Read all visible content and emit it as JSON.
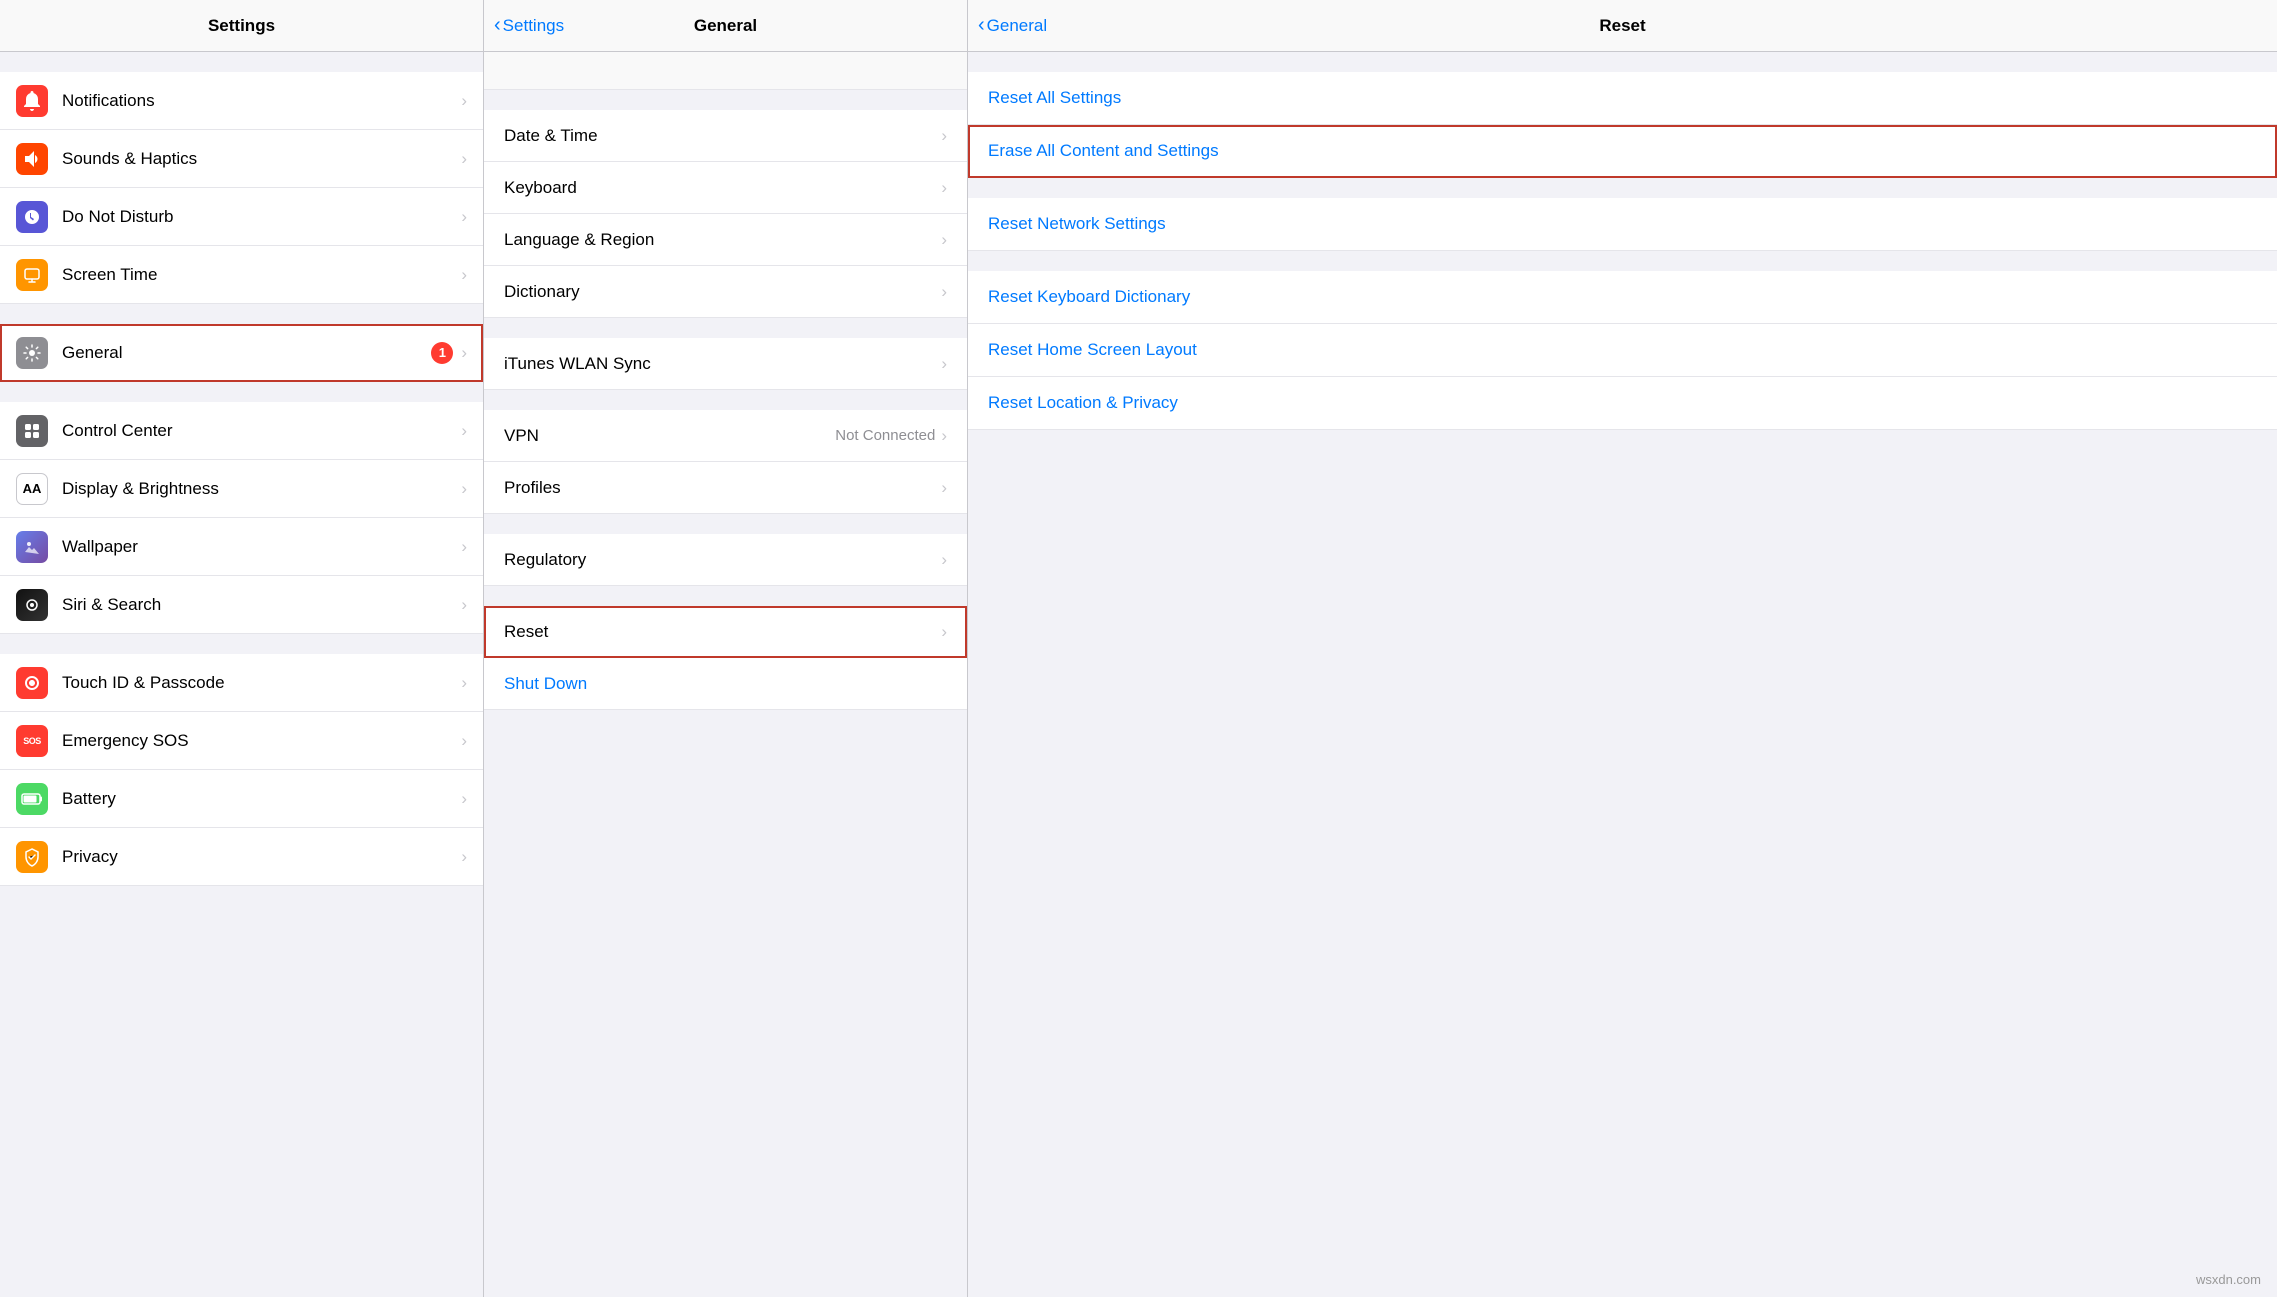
{
  "settings": {
    "title": "Settings",
    "items": [
      {
        "id": "notifications",
        "label": "Notifications",
        "icon": "🔔",
        "bg": "#ff3b30",
        "chevron": true,
        "highlighted": false
      },
      {
        "id": "sounds",
        "label": "Sounds & Haptics",
        "icon": "🔊",
        "bg": "#ff4500",
        "chevron": true,
        "highlighted": false
      },
      {
        "id": "donotdisturb",
        "label": "Do Not Disturb",
        "icon": "🌙",
        "bg": "#5856d6",
        "chevron": true,
        "highlighted": false
      },
      {
        "id": "screentime",
        "label": "Screen Time",
        "icon": "⌛",
        "bg": "#ff9500",
        "chevron": true,
        "highlighted": false
      },
      {
        "id": "general",
        "label": "General",
        "icon": "⚙️",
        "bg": "#8e8e93",
        "badge": "1",
        "chevron": true,
        "highlighted": true
      },
      {
        "id": "controlcenter",
        "label": "Control Center",
        "icon": "⚙",
        "bg": "#636366",
        "chevron": true,
        "highlighted": false
      },
      {
        "id": "displaybrightness",
        "label": "Display & Brightness",
        "icon": "AA",
        "bg": "aa",
        "chevron": true,
        "highlighted": false
      },
      {
        "id": "wallpaper",
        "label": "Wallpaper",
        "icon": "🌸",
        "bg": "wallpaper",
        "chevron": true,
        "highlighted": false
      },
      {
        "id": "siri",
        "label": "Siri & Search",
        "icon": "◎",
        "bg": "siri",
        "chevron": true,
        "highlighted": false
      },
      {
        "id": "touchid",
        "label": "Touch ID & Passcode",
        "icon": "👆",
        "bg": "#ff3b30",
        "chevron": true,
        "highlighted": false
      },
      {
        "id": "emergencysos",
        "label": "Emergency SOS",
        "icon": "SOS",
        "bg": "#ff3b30",
        "chevron": true,
        "highlighted": false
      },
      {
        "id": "battery",
        "label": "Battery",
        "icon": "🔋",
        "bg": "#4cd964",
        "chevron": true,
        "highlighted": false
      },
      {
        "id": "privacy",
        "label": "Privacy",
        "icon": "✋",
        "bg": "#ff9500",
        "chevron": true,
        "highlighted": false
      }
    ]
  },
  "general": {
    "title": "General",
    "back_label": "Settings",
    "items": [
      {
        "id": "datetime",
        "label": "Date & Time",
        "chevron": true
      },
      {
        "id": "keyboard",
        "label": "Keyboard",
        "chevron": true
      },
      {
        "id": "language",
        "label": "Language & Region",
        "chevron": true
      },
      {
        "id": "dictionary",
        "label": "Dictionary",
        "chevron": true
      },
      {
        "id": "ituneswlan",
        "label": "iTunes WLAN Sync",
        "chevron": true
      },
      {
        "id": "vpn",
        "label": "VPN",
        "value": "Not Connected",
        "chevron": true
      },
      {
        "id": "profiles",
        "label": "Profiles",
        "chevron": true
      },
      {
        "id": "regulatory",
        "label": "Regulatory",
        "chevron": true
      },
      {
        "id": "reset",
        "label": "Reset",
        "chevron": true,
        "highlighted": true
      },
      {
        "id": "shutdown",
        "label": "Shut Down",
        "isBlue": true,
        "chevron": false
      }
    ]
  },
  "reset": {
    "title": "Reset",
    "back_label": "General",
    "items": [
      {
        "id": "resetall",
        "label": "Reset All Settings",
        "highlighted": false
      },
      {
        "id": "eraseall",
        "label": "Erase All Content and Settings",
        "highlighted": true
      },
      {
        "id": "resetnetwork",
        "label": "Reset Network Settings",
        "highlighted": false
      },
      {
        "id": "resetkeyboard",
        "label": "Reset Keyboard Dictionary",
        "highlighted": false
      },
      {
        "id": "resethome",
        "label": "Reset Home Screen Layout",
        "highlighted": false
      },
      {
        "id": "resetlocation",
        "label": "Reset Location & Privacy",
        "highlighted": false
      }
    ]
  },
  "watermark": "wsxdn.com"
}
